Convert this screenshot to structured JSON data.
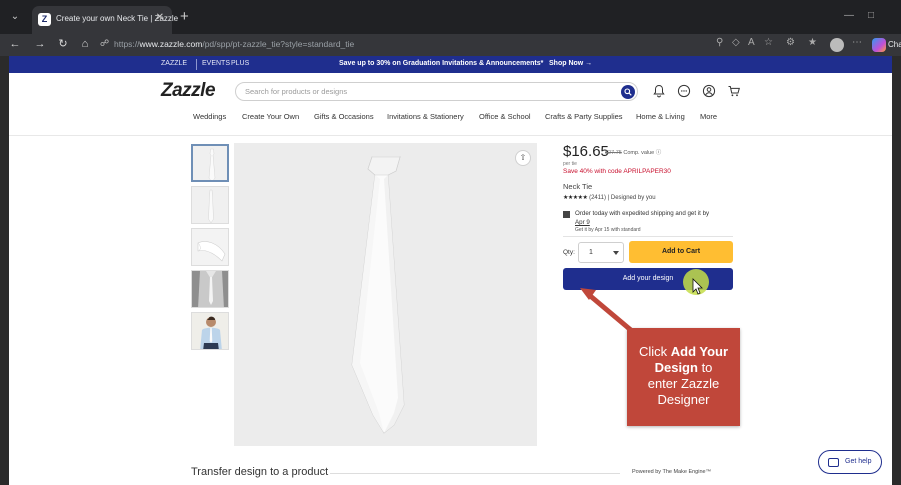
{
  "browser": {
    "tab_title": "Create your own Neck Tie | Zazzle",
    "url_prefix": "https://",
    "url_domain": "www.zazzle.com",
    "url_path": "/pd/spp/pt-zazzle_tie?style=standard_tie",
    "copilot_label": "Cha"
  },
  "promo": {
    "zazzle": "ZAZZLE",
    "events": "EVENTS",
    "plus": "PLUS",
    "message": "Save up to 30% on Graduation Invitations & Announcements*",
    "shop_now": "Shop Now →"
  },
  "header": {
    "logo": "Zazzle",
    "search_placeholder": "Search for products or designs"
  },
  "nav": {
    "categories": [
      "Weddings",
      "Create Your Own",
      "Gifts & Occasions",
      "Invitations & Stationery",
      "Office & School",
      "Crafts & Party Supplies",
      "Home & Living",
      "More"
    ]
  },
  "product": {
    "price": "$16.65",
    "compare_price": "$27.75",
    "compare_label": "Comp. value",
    "per_unit": "per tie",
    "promo_code": "Save 40% with code APRILPAPER30",
    "name": "Neck Tie",
    "rating_stars": "★★★★★",
    "rating_text": "(2411) | Designed by you",
    "shipping_line1": "Order today with expedited shipping and get it by",
    "shipping_date": "Apr 9",
    "shipping_line3": "Get it by Apr 15 with standard",
    "qty_label": "Qty:",
    "qty_value": "1",
    "add_to_cart": "Add to Cart",
    "add_design": "Add your design"
  },
  "tutorial": {
    "line1": "Click",
    "bold1": "Add Your",
    "bold2": "Design",
    "line2b": "to",
    "line3": "enter Zazzle",
    "line4": "Designer",
    "color": "#c0473a"
  },
  "footer": {
    "transfer": "Transfer design to a product",
    "powered": "Powered by The Make Engine™",
    "get_help": "Get help"
  },
  "colors": {
    "brand_navy": "#1f2e8e",
    "cart_yellow": "#ffbe32",
    "promo_red": "#c8102e"
  }
}
